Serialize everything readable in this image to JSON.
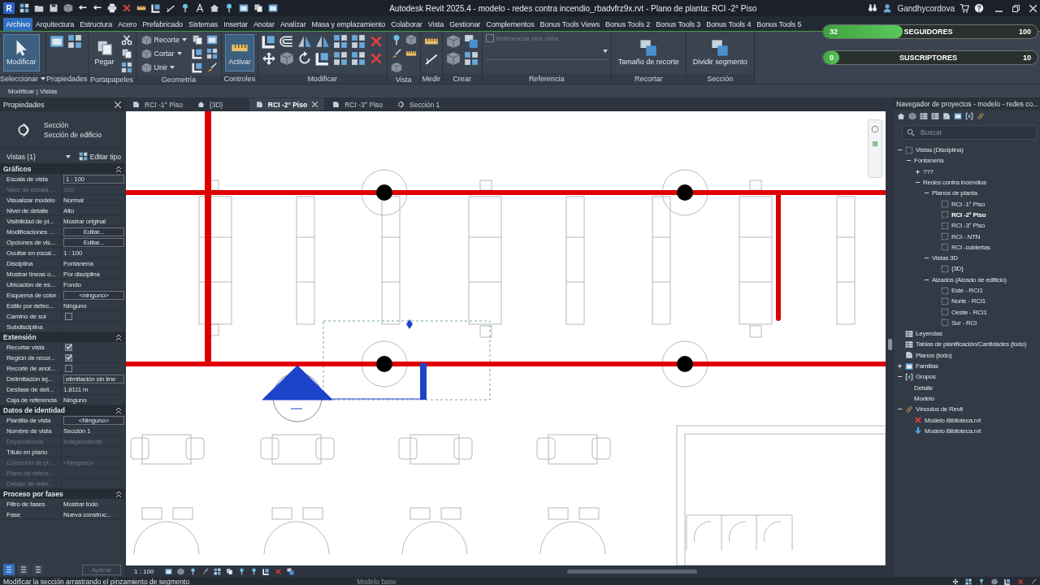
{
  "title_bar": {
    "logo": "R",
    "title": "Autodesk Revit 2025.4 - modelo - redes contra incendio_rbadvfrz9x.rvt - Plano de planta: RCI -2° Piso",
    "user": "Gandhycordova"
  },
  "menu_tabs": [
    {
      "label": "Archivo",
      "selected": true
    },
    {
      "label": "Arquitectura",
      "selected": false
    },
    {
      "label": "Estructura",
      "selected": false
    },
    {
      "label": "Acero",
      "selected": false
    },
    {
      "label": "Prefabricado",
      "selected": false
    },
    {
      "label": "Sistemas",
      "selected": false
    },
    {
      "label": "Insertar",
      "selected": false
    },
    {
      "label": "Anotar",
      "selected": false
    },
    {
      "label": "Analizar",
      "selected": false
    },
    {
      "label": "Masa y emplazamiento",
      "selected": false
    },
    {
      "label": "Colaborar",
      "selected": false
    },
    {
      "label": "Vista",
      "selected": false
    },
    {
      "label": "Gestionar",
      "selected": false
    },
    {
      "label": "Complementos",
      "selected": false
    },
    {
      "label": "Bonus Tools Views",
      "selected": false
    },
    {
      "label": "Bonus Tools 2",
      "selected": false
    },
    {
      "label": "Bonus Tools 3",
      "selected": false
    },
    {
      "label": "Bonus Tools 4",
      "selected": false
    },
    {
      "label": "Bonus Tools 5",
      "selected": false
    }
  ],
  "ribbon": {
    "panels": [
      {
        "kind": "select",
        "label": "Seleccionar",
        "tools": [
          {
            "kind": "large",
            "label": "Modificar",
            "active": true
          }
        ]
      },
      {
        "kind": "properties",
        "label": "Propiedades"
      },
      {
        "kind": "clipboard",
        "label": "Portapapeles",
        "tools": [
          {
            "kind": "large",
            "label": "Pegar",
            "active": false
          }
        ]
      },
      {
        "kind": "geometry",
        "label": "Geometría",
        "tools": [
          {
            "kind": "small",
            "label": "Recorte"
          },
          {
            "kind": "small",
            "label": "Cortar"
          },
          {
            "kind": "small",
            "label": "Unir"
          }
        ]
      },
      {
        "kind": "controls",
        "label": "Controles",
        "tools": [
          {
            "kind": "large",
            "label": "Activar",
            "active": true
          }
        ]
      },
      {
        "kind": "modify",
        "label": "Modificar"
      },
      {
        "kind": "view",
        "label": "Vista"
      },
      {
        "kind": "measure",
        "label": "Medir"
      },
      {
        "kind": "create",
        "label": "Crear"
      },
      {
        "kind": "reference",
        "label": "Referencia",
        "tools": [
          {
            "kind": "check",
            "label": "Referenciar otra vista",
            "checked": false,
            "disabled": true
          }
        ]
      },
      {
        "kind": "crop",
        "label": "Recortar",
        "tools": [
          {
            "kind": "large",
            "label": "Tamaño de recorte",
            "active": false
          }
        ]
      },
      {
        "kind": "section",
        "label": "Sección",
        "tools": [
          {
            "kind": "large",
            "label": "Dividir segmento",
            "active": false
          }
        ]
      }
    ]
  },
  "context_bar": "Modificar | Vistas",
  "overlay": {
    "goals": [
      {
        "label": "SEGUIDORES",
        "current": "32",
        "target": "100",
        "level": 0.32
      },
      {
        "label": "SUSCRIPTORES",
        "current": "0",
        "target": "10",
        "level": 0
      }
    ]
  },
  "properties": {
    "title": "Propiedades",
    "type_family": "Sección",
    "type_name": "Sección de edificio",
    "instance_filter": "Vistas (1)",
    "edit_type": "Editar tipo",
    "sections": [
      {
        "title": "Gráficos",
        "rows": [
          {
            "label": "Escala de vista",
            "value": "1 : 100",
            "kind": "field",
            "disabled": false
          },
          {
            "label": "Valor de escala ...",
            "value": "100",
            "kind": "text",
            "disabled": true
          },
          {
            "label": "Visualizar modelo",
            "value": "Normal",
            "kind": "text",
            "disabled": false
          },
          {
            "label": "Nivel de detalle",
            "value": "Alto",
            "kind": "text",
            "disabled": false
          },
          {
            "label": "Visibilidad de pi...",
            "value": "Mostrar original",
            "kind": "text",
            "disabled": false
          },
          {
            "label": "Modificaciones ...",
            "value": "Editar...",
            "kind": "button",
            "disabled": false
          },
          {
            "label": "Opciones de vis...",
            "value": "Editar...",
            "kind": "button",
            "disabled": false
          },
          {
            "label": "Ocultar en escal...",
            "value": "1 : 100",
            "kind": "text",
            "disabled": false
          },
          {
            "label": "Disciplina",
            "value": "Fontanería",
            "kind": "text",
            "disabled": false
          },
          {
            "label": "Mostrar líneas o...",
            "value": "Por disciplina",
            "kind": "text",
            "disabled": false
          },
          {
            "label": "Ubicación de es...",
            "value": "Fondo",
            "kind": "text",
            "disabled": false
          },
          {
            "label": "Esquema de color",
            "value": "<ninguno>",
            "kind": "button",
            "disabled": false
          },
          {
            "label": "Estilo por defec...",
            "value": "Ninguno",
            "kind": "text",
            "disabled": false
          },
          {
            "label": "Camino de sol",
            "kind": "checkbox",
            "checked": false,
            "disabled": false
          },
          {
            "label": "Subdisciplina",
            "kind": "text",
            "disabled": false
          }
        ]
      },
      {
        "title": "Extensión",
        "rows": [
          {
            "label": "Recortar vista",
            "kind": "checkbox",
            "checked": true,
            "disabled": false
          },
          {
            "label": "Región de recor...",
            "kind": "checkbox",
            "checked": true,
            "disabled": false
          },
          {
            "label": "Recorte de anot...",
            "kind": "checkbox",
            "checked": false,
            "disabled": false
          },
          {
            "label": "Delimitación lej...",
            "value": "elimitación sin líne",
            "kind": "field",
            "disabled": false
          },
          {
            "label": "Desfase de deli...",
            "value": "1.8111 m",
            "kind": "text",
            "disabled": false
          },
          {
            "label": "Caja de referencia",
            "value": "Ninguno",
            "kind": "text",
            "disabled": false
          }
        ]
      },
      {
        "title": "Datos de identidad",
        "rows": [
          {
            "label": "Plantilla de vista",
            "value": "<Ninguno>",
            "kind": "button",
            "disabled": false
          },
          {
            "label": "Nombre de vista",
            "value": "Sección 1",
            "kind": "text",
            "disabled": false
          },
          {
            "label": "Dependencia",
            "value": "Independiente",
            "kind": "text",
            "disabled": true
          },
          {
            "label": "Título en plano",
            "kind": "text",
            "disabled": false
          },
          {
            "label": "Colección de pl...",
            "value": "<Ninguno>",
            "kind": "text",
            "disabled": true
          },
          {
            "label": "Plano de refere...",
            "kind": "text",
            "disabled": true
          },
          {
            "label": "Detalle de refer...",
            "kind": "text",
            "disabled": true
          }
        ]
      },
      {
        "title": "Proceso por fases",
        "rows": [
          {
            "label": "Filtro de fases",
            "value": "Mostrar todo",
            "kind": "text",
            "disabled": false
          },
          {
            "label": "Fase",
            "value": "Nueva construc...",
            "kind": "text",
            "disabled": false
          }
        ]
      }
    ],
    "apply": {
      "label": "Aplicar",
      "disabled": true
    }
  },
  "view_tabs": [
    {
      "label": "RCI -1° Piso",
      "kind": "plan",
      "selected": false
    },
    {
      "label": "{3D}",
      "kind": "model",
      "selected": false
    },
    {
      "label": "RCI -2° Piso",
      "kind": "plan",
      "selected": true
    },
    {
      "label": "RCI -3° Piso",
      "kind": "plan",
      "selected": false
    },
    {
      "label": "Sección 1",
      "kind": "section",
      "selected": false
    }
  ],
  "view_bar": {
    "scale": "1 : 100"
  },
  "browser": {
    "title": "Navegador de proyectos - modelo - redes co...",
    "search": {
      "placeholder": "Buscar"
    },
    "tree": [
      {
        "label": "Vistas (Disciplina)",
        "kind": "views",
        "expanded": true,
        "children": [
          {
            "label": "Fontanería",
            "expanded": true,
            "children": [
              {
                "label": "???",
                "expanded": false
              },
              {
                "label": "Redes contra incendios",
                "expanded": true,
                "children": [
                  {
                    "label": "Planos de planta",
                    "expanded": true,
                    "children": [
                      {
                        "label": "RCI -1° Piso",
                        "kind": "view",
                        "selected": false
                      },
                      {
                        "label": "RCI -2° Piso",
                        "kind": "view",
                        "selected": true
                      },
                      {
                        "label": "RCI -3° Piso",
                        "kind": "view",
                        "selected": false
                      },
                      {
                        "label": "RCI - NTN",
                        "kind": "view",
                        "selected": false
                      },
                      {
                        "label": "RCI -cubiertas",
                        "kind": "view",
                        "selected": false
                      }
                    ]
                  },
                  {
                    "label": "Vistas 3D",
                    "expanded": true,
                    "children": [
                      {
                        "label": "{3D}",
                        "kind": "view",
                        "selected": false
                      }
                    ]
                  },
                  {
                    "label": "Alzados (Alzado de edificio)",
                    "expanded": true,
                    "children": [
                      {
                        "label": "Este - RCI1",
                        "kind": "view",
                        "selected": false
                      },
                      {
                        "label": "Norte - RCI1",
                        "kind": "view",
                        "selected": false
                      },
                      {
                        "label": "Oeste - RCI1",
                        "kind": "view",
                        "selected": false
                      },
                      {
                        "label": "Sur - RCI",
                        "kind": "view",
                        "selected": false
                      }
                    ]
                  }
                ]
              }
            ]
          }
        ]
      },
      {
        "label": "Leyendas",
        "kind": "legends"
      },
      {
        "label": "Tablas de planificación/Cantidades (todo)",
        "kind": "schedules"
      },
      {
        "label": "Planos (todo)",
        "kind": "sheets"
      },
      {
        "label": "Familias",
        "kind": "families",
        "expanded": false
      },
      {
        "label": "Grupos",
        "kind": "groups",
        "expanded": true,
        "children": [
          {
            "label": "Detalle"
          },
          {
            "label": "Modelo"
          }
        ]
      },
      {
        "label": "Vínculos de Revit",
        "kind": "links",
        "expanded": true,
        "children": [
          {
            "label": "Modelo Biblioteca.rvt",
            "kind": "link-missing"
          },
          {
            "label": "Modelo Biblioteca.rvt",
            "kind": "link-loaded"
          }
        ]
      }
    ]
  },
  "status_bar": {
    "message": "Modificar la sección arrastrando el pinzamiento de segmento",
    "model": "Modelo base"
  }
}
